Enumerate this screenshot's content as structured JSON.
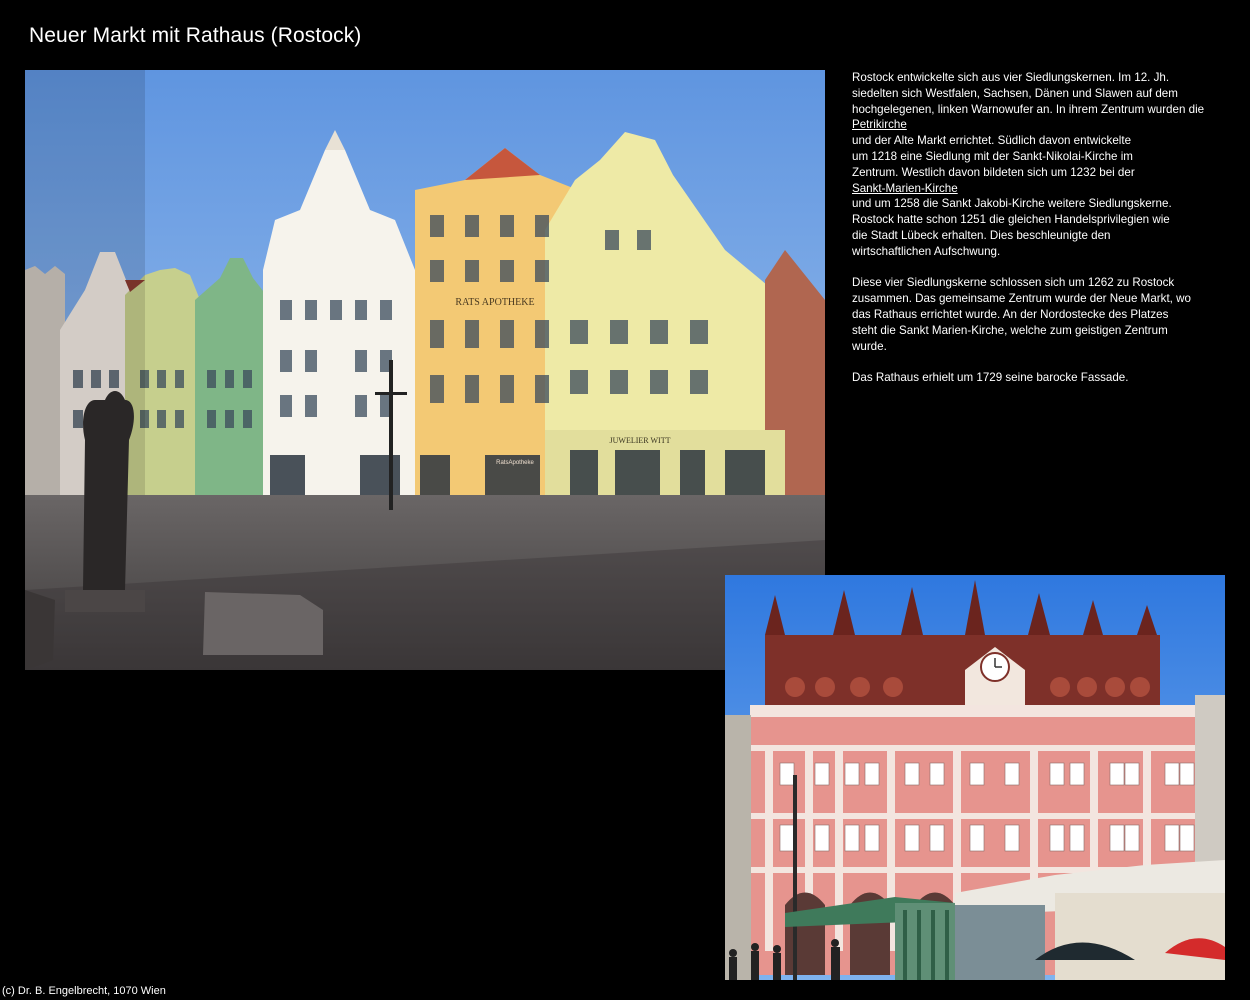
{
  "page": {
    "title": "Neuer Markt mit Rathaus (Rostock)",
    "footer": "(c) Dr. B. Engelbrecht, 1070 Wien"
  },
  "photos": {
    "main": {
      "signs": {
        "rats_apotheke": "RATS APOTHEKE",
        "juwelier": "JUWELIER WITT",
        "ratsapotheke_shop": "RatsApotheke"
      }
    }
  },
  "article": {
    "paragraph1": {
      "l1": "Rostock entwickelte sich aus vier Siedlungskernen. Im 12. Jh.",
      "l2": "siedelten sich Westfalen, Sachsen, Dänen und Slawen auf dem",
      "l3": "hochgelegenen, linken Warnowufer an. In ihrem Zentrum wurden die",
      "link1": "Petrikirche",
      "l4": "und der Alte Markt errichtet. Südlich davon entwickelte",
      "l5": "um 1218 eine Siedlung mit der Sankt-Nikolai-Kirche im",
      "l6": "Zentrum. Westlich davon bildeten sich um 1232 bei der",
      "link2": "Sankt-Marien-Kirche",
      "l7": "und um 1258 die Sankt Jakobi-Kirche weitere Siedlungskerne.",
      "l8": "Rostock hatte schon 1251 die gleichen Handelsprivilegien wie",
      "l9": "die Stadt Lübeck erhalten. Dies beschleunigte den",
      "l10": "wirtschaftlichen Aufschwung."
    },
    "paragraph2": {
      "l1": "Diese vier Siedlungskerne schlossen sich um 1262 zu Rostock",
      "l2": "zusammen. Das gemeinsame Zentrum wurde der Neue Markt, wo",
      "l3": "das Rathaus errichtet wurde. An der Nordostecke des Platzes",
      "l4": "steht die Sankt Marien-Kirche, welche zum geistigen Zentrum",
      "l5": "wurde."
    },
    "paragraph3": {
      "l1": "Das Rathaus erhielt um 1729 seine barocke Fassade."
    }
  }
}
